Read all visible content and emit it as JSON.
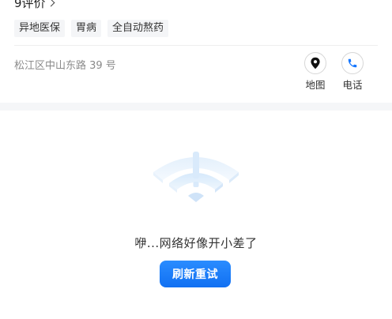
{
  "store": {
    "reviews_label": "9评价",
    "tags": [
      "异地医保",
      "胃病",
      "全自动熬药"
    ],
    "address": "松江区中山东路 39 号",
    "actions": {
      "map_label": "地图",
      "phone_label": "电话"
    }
  },
  "error": {
    "message": "咿...网络好像开小差了",
    "retry_label": "刷新重试"
  },
  "colors": {
    "accent": "#1677ff",
    "band": "#f5f6f8",
    "tag_bg": "#f4f5f7"
  }
}
